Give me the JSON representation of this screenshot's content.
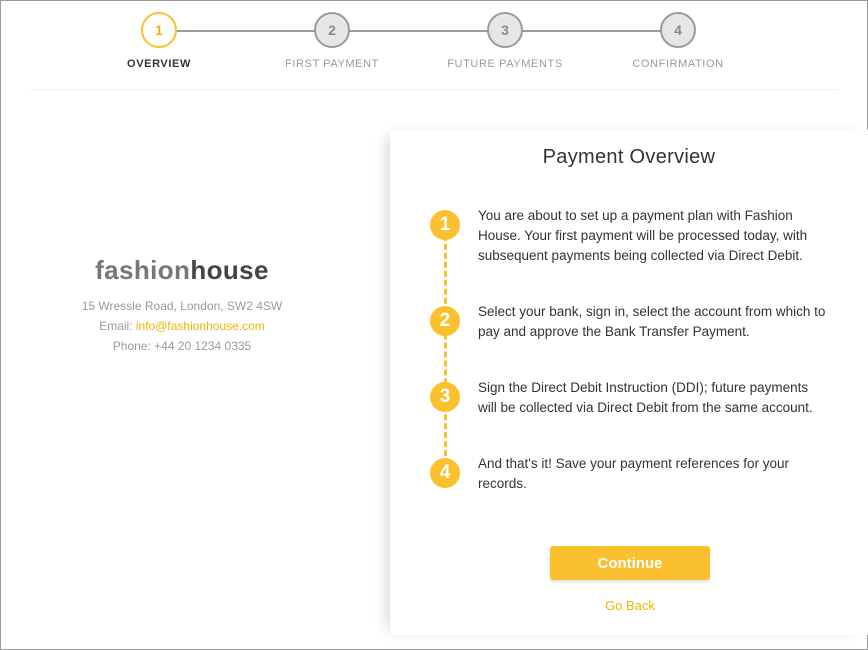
{
  "stepper": {
    "steps": [
      {
        "number": "1",
        "label": "OVERVIEW",
        "active": true
      },
      {
        "number": "2",
        "label": "FIRST PAYMENT",
        "active": false
      },
      {
        "number": "3",
        "label": "FUTURE PAYMENTS",
        "active": false
      },
      {
        "number": "4",
        "label": "CONFIRMATION",
        "active": false
      }
    ]
  },
  "merchant": {
    "logo_part1": "fashion",
    "logo_part2": "house",
    "address": "15 Wressle Road, London, SW2 4SW",
    "email_label": "Email:",
    "email": "info@fashionhouse.com",
    "phone": "Phone: +44 20 1234 0335"
  },
  "overview": {
    "title": "Payment Overview",
    "items": [
      {
        "number": "1",
        "text": "You are about to set up a payment plan with Fashion House. Your first payment will be processed today, with subsequent payments being collected via Direct Debit."
      },
      {
        "number": "2",
        "text": "Select your bank, sign in, select the account from which to pay and approve the Bank Transfer Payment."
      },
      {
        "number": "3",
        "text": "Sign the Direct Debit Instruction (DDI); future payments will be collected via Direct Debit from the same account."
      },
      {
        "number": "4",
        "text": "And that's it! Save your payment references for your records."
      }
    ],
    "continue_label": "Continue",
    "goback_label": "Go Back"
  },
  "colors": {
    "accent": "#fbc02d",
    "inactive_step": "#9b9b9b",
    "text": "#333333",
    "muted": "#9a9a9a"
  }
}
